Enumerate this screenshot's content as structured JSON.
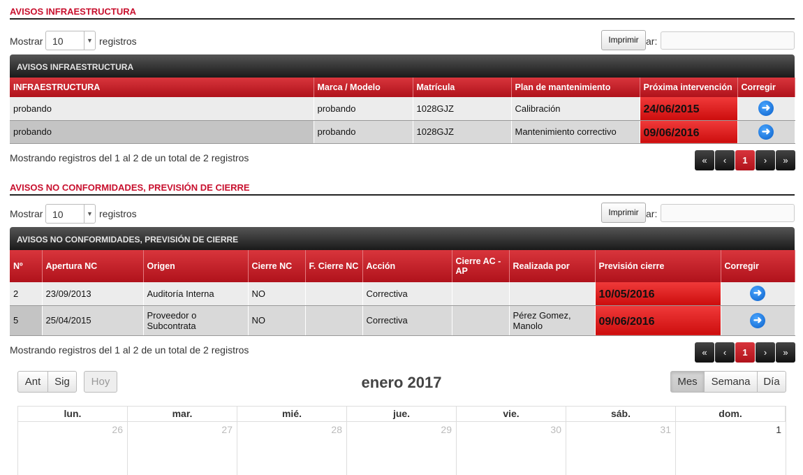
{
  "section1": {
    "title": "AVISOS INFRAESTRUCTURA",
    "show_label": "Mostrar",
    "show_value": "10",
    "records_label": "registros",
    "print_label": "Imprimir",
    "search_label": "car:",
    "panel_title": "AVISOS INFRAESTRUCTURA",
    "columns": [
      "INFRAESTRUCTURA",
      "Marca / Modelo",
      "Matrícula",
      "Plan de mantenimiento",
      "Próxima intervención",
      "Corregir"
    ],
    "rows": [
      [
        "probando",
        "probando",
        "1028GJZ",
        "Calibración",
        "24/06/2015"
      ],
      [
        "probando",
        "probando",
        "1028GJZ",
        "Mantenimiento correctivo",
        "09/06/2016"
      ]
    ],
    "info": "Mostrando registros del 1 al 2 de un total de 2 registros",
    "pager": [
      "«",
      "‹",
      "1",
      "›",
      "»"
    ]
  },
  "section2": {
    "title": "AVISOS NO CONFORMIDADES, PREVISIÓN DE CIERRE",
    "show_label": "Mostrar",
    "show_value": "10",
    "records_label": "registros",
    "print_label": "Imprimir",
    "search_label": "car:",
    "panel_title": "AVISOS NO CONFORMIDADES, PREVISIÓN DE CIERRE",
    "columns": [
      "Nº",
      "Apertura NC",
      "Origen",
      "Cierre NC",
      "F. Cierre NC",
      "Acción",
      "Cierre AC - AP",
      "Realizada por",
      "Previsión cierre",
      "Corregir"
    ],
    "rows": [
      [
        "2",
        "23/09/2013",
        "Auditoría Interna",
        "NO",
        "",
        "Correctiva",
        "",
        "",
        "10/05/2016"
      ],
      [
        "5",
        "25/04/2015",
        "Proveedor o Subcontrata",
        "NO",
        "",
        "Correctiva",
        "",
        "Pérez Gomez, Manolo",
        "09/06/2016"
      ]
    ],
    "info": "Mostrando registros del 1 al 2 de un total de 2 registros",
    "pager": [
      "«",
      "‹",
      "1",
      "›",
      "»"
    ]
  },
  "calendar": {
    "prev_label": "Ant",
    "next_label": "Sig",
    "today_label": "Hoy",
    "title": "enero 2017",
    "views": [
      "Mes",
      "Semana",
      "Día"
    ],
    "active_view": "Mes",
    "day_headers": [
      "lun.",
      "mar.",
      "mié.",
      "jue.",
      "vie.",
      "sáb.",
      "dom."
    ],
    "first_week": [
      "26",
      "27",
      "28",
      "29",
      "30",
      "31",
      "1"
    ]
  },
  "colors": {
    "accent": "#c8102e",
    "header_dark": "#1a1a1a",
    "date_alert": "#e02020",
    "icon_blue": "#0a6fdc"
  },
  "icons": {
    "correct": "arrow-right-circle-icon",
    "select_caret": "chevron-down-icon"
  }
}
